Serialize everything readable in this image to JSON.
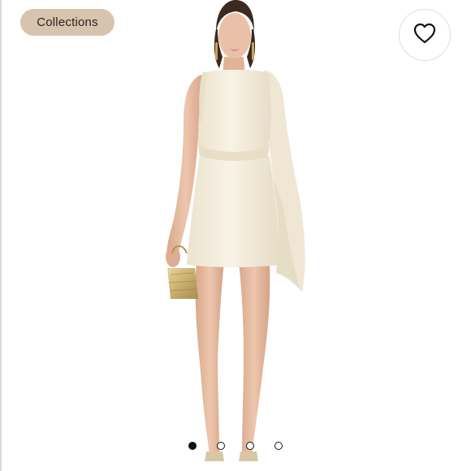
{
  "header": {
    "collections_label": "Collections"
  },
  "icons": {
    "like": "heart-icon"
  },
  "carousel": {
    "total": 4,
    "active_index": 1
  },
  "colors": {
    "collections_bg": "#d8c3ae",
    "dress": "#f5efe1",
    "dot_active": "#111111"
  }
}
